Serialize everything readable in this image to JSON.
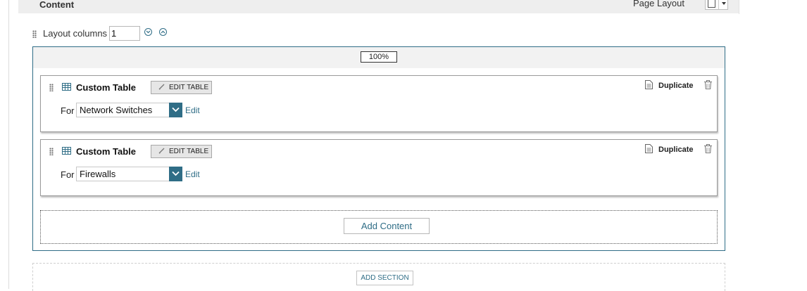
{
  "header": {
    "title": "Content",
    "page_layout_label": "Page Layout"
  },
  "layout": {
    "columns_label": "Layout columns",
    "columns_value": "1"
  },
  "section": {
    "width_label": "100%",
    "widgets": [
      {
        "title": "Custom Table",
        "edit_table_label": "EDIT TABLE",
        "for_label": "For",
        "for_value": "Network Switches",
        "edit_link": "Edit",
        "duplicate_label": "Duplicate"
      },
      {
        "title": "Custom Table",
        "edit_table_label": "EDIT TABLE",
        "for_label": "For",
        "for_value": "Firewalls",
        "edit_link": "Edit",
        "duplicate_label": "Duplicate"
      }
    ],
    "add_content_label": "Add Content"
  },
  "add_section_label": "ADD SECTION",
  "icons": {
    "drag": "drag-handle-icon",
    "table": "table-grid-icon",
    "pencil": "pencil-icon",
    "duplicate": "document-copy-icon",
    "trash": "trash-icon",
    "collapse": "chevron-down-circle-icon",
    "expand": "chevron-up-circle-icon"
  },
  "colors": {
    "accent": "#2f6d86",
    "header_bg": "#eeeeee",
    "button_bg": "#e6e6e6"
  }
}
